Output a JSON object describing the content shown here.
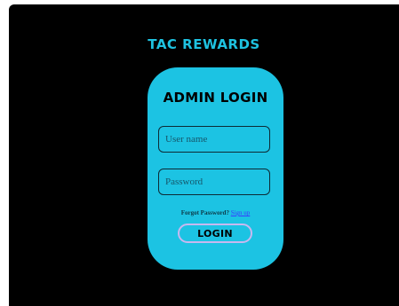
{
  "brand": {
    "title": "TAC REWARDS"
  },
  "login": {
    "heading": "ADMIN LOGIN",
    "username_placeholder": "User name",
    "username_value": "",
    "password_placeholder": "Password",
    "password_value": "",
    "forgot_text": "Forgot Password?",
    "signup_link": "Sign up",
    "submit_label": "LOGIN"
  },
  "colors": {
    "background": "#000000",
    "accent": "#1cc3e3",
    "button_border": "#c8b8f0",
    "link": "#3a3aff"
  }
}
